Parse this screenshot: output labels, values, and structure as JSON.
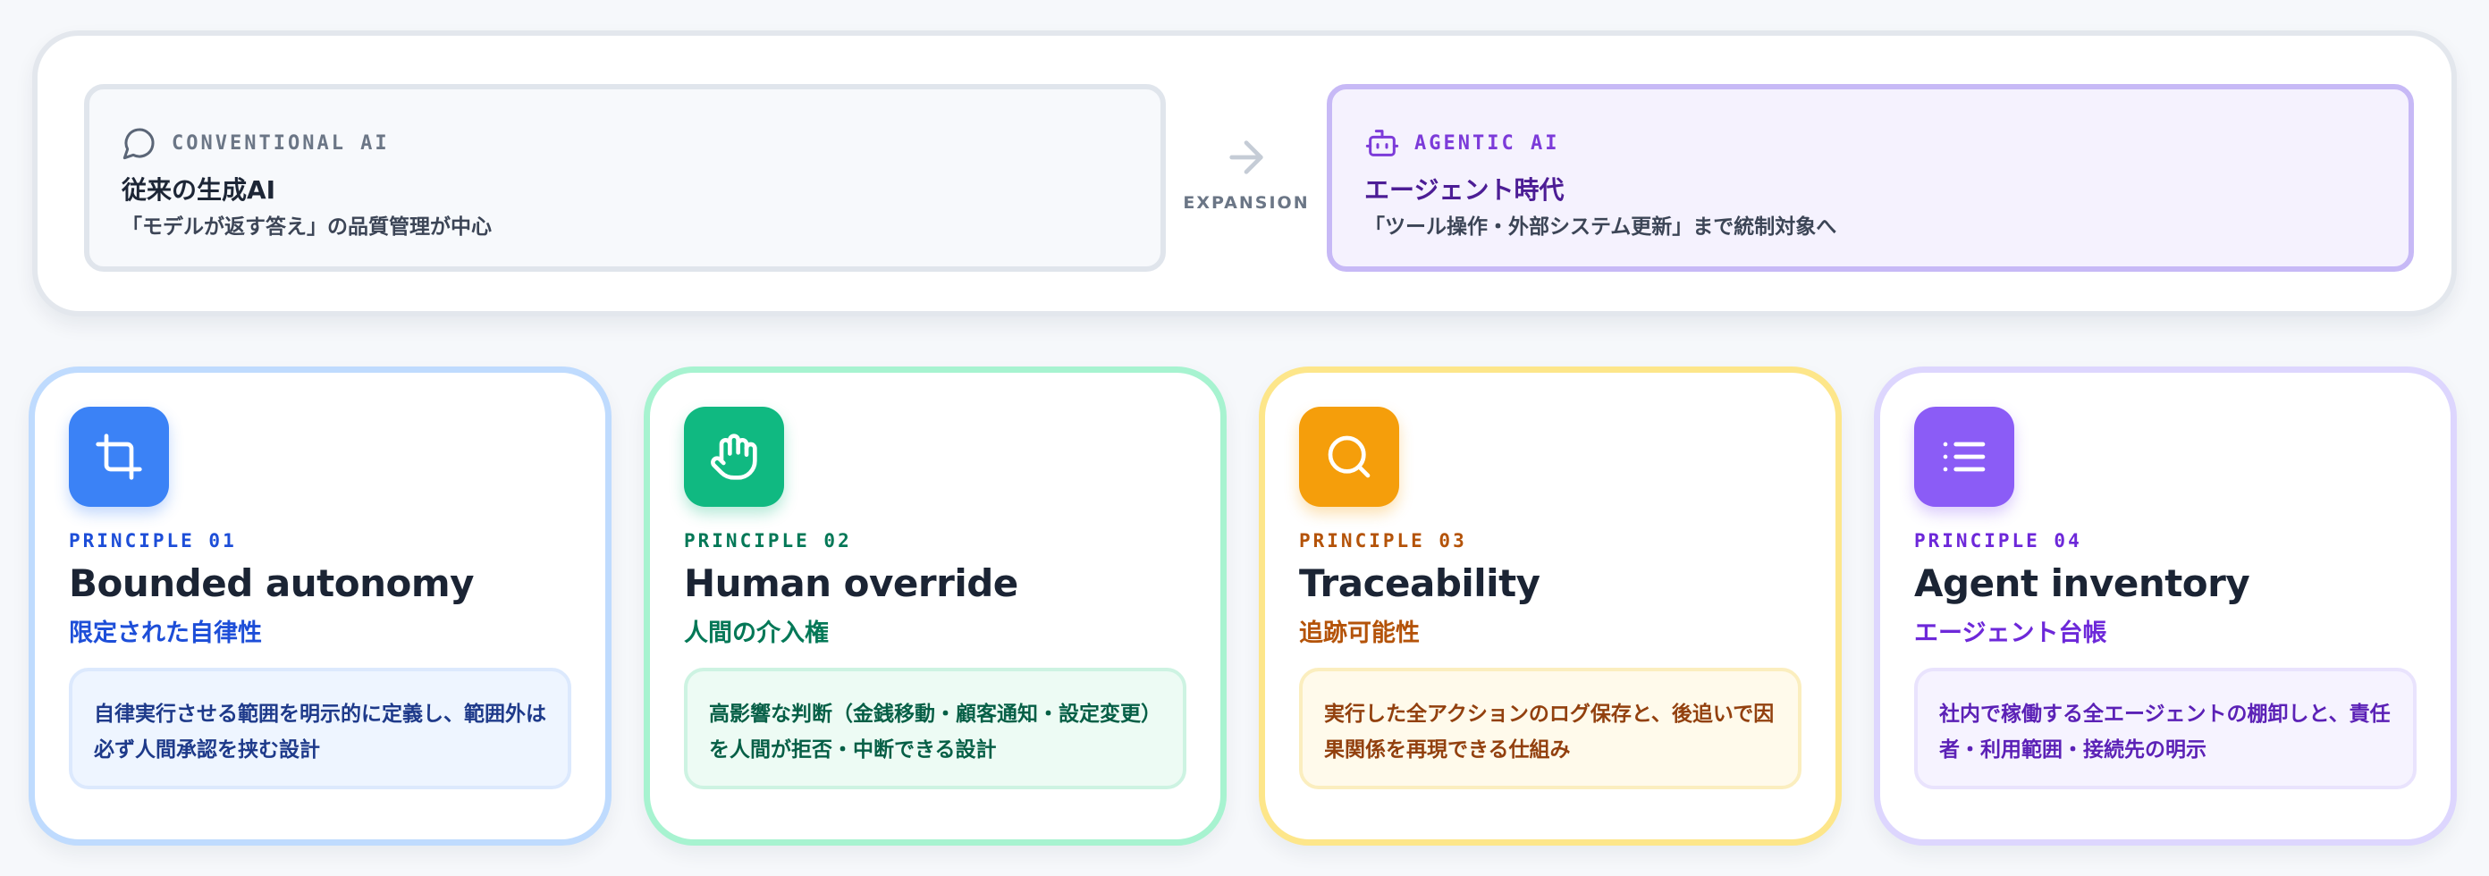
{
  "comparison": {
    "conventional": {
      "icon": "message-circle-icon",
      "tag": "CONVENTIONAL AI",
      "title": "従来の生成AI",
      "description": "「モデルが返す答え」の品質管理が中心"
    },
    "expansion": {
      "icon": "arrow-right-icon",
      "label": "EXPANSION"
    },
    "agentic": {
      "icon": "bot-icon",
      "tag": "AGENTIC AI",
      "title": "エージェント時代",
      "description": "「ツール操作・外部システム更新」まで統制対象へ"
    }
  },
  "principles": [
    {
      "icon": "crop-icon",
      "number": "PRINCIPLE 01",
      "title": "Bounded autonomy",
      "subtitle": "限定された自律性",
      "description": "自律実行させる範囲を明示的に定義し、範囲外は必ず人間承認を挟む設計",
      "accent": "#3b82f6"
    },
    {
      "icon": "hand-icon",
      "number": "PRINCIPLE 02",
      "title": "Human override",
      "subtitle": "人間の介入権",
      "description": "高影響な判断（金銭移動・顧客通知・設定変更）を人間が拒否・中断できる設計",
      "accent": "#10b981"
    },
    {
      "icon": "search-icon",
      "number": "PRINCIPLE 03",
      "title": "Traceability",
      "subtitle": "追跡可能性",
      "description": "実行した全アクションのログ保存と、後追いで因果関係を再現できる仕組み",
      "accent": "#f59e0b"
    },
    {
      "icon": "list-icon",
      "number": "PRINCIPLE 04",
      "title": "Agent inventory",
      "subtitle": "エージェント台帳",
      "description": "社内で稼働する全エージェントの棚卸しと、責任者・利用範囲・接続先の明示",
      "accent": "#8b5cf6"
    }
  ]
}
